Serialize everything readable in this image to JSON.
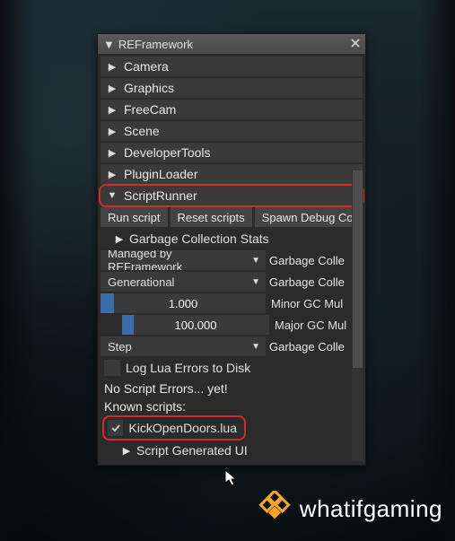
{
  "window": {
    "title": "REFramework"
  },
  "tree": {
    "camera": "Camera",
    "graphics": "Graphics",
    "freecam": "FreeCam",
    "scene": "Scene",
    "devtools": "DeveloperTools",
    "pluginloader": "PluginLoader",
    "scriptrunner": "ScriptRunner"
  },
  "buttons": {
    "run": "Run script",
    "reset": "Reset scripts",
    "spawn": "Spawn Debug Co"
  },
  "gc_header": "Garbage Collection Stats",
  "combos": {
    "managed": {
      "label": "Managed by REFramework",
      "side": "Garbage Colle"
    },
    "generational": {
      "label": "Generational",
      "side": "Garbage Colle"
    },
    "step": {
      "label": "Step",
      "side": "Garbage Colle"
    }
  },
  "sliders": {
    "minor": {
      "value": "1.000",
      "label": "Minor GC Mul"
    },
    "major": {
      "value": "100.000",
      "label": "Major GC Mul"
    }
  },
  "log_errors": "Log Lua Errors to Disk",
  "status": "No Script Errors... yet!",
  "known_scripts_label": "Known scripts:",
  "script_name": "KickOpenDoors.lua",
  "script_gen_ui": "Script Generated UI",
  "brand": "whatifgaming"
}
